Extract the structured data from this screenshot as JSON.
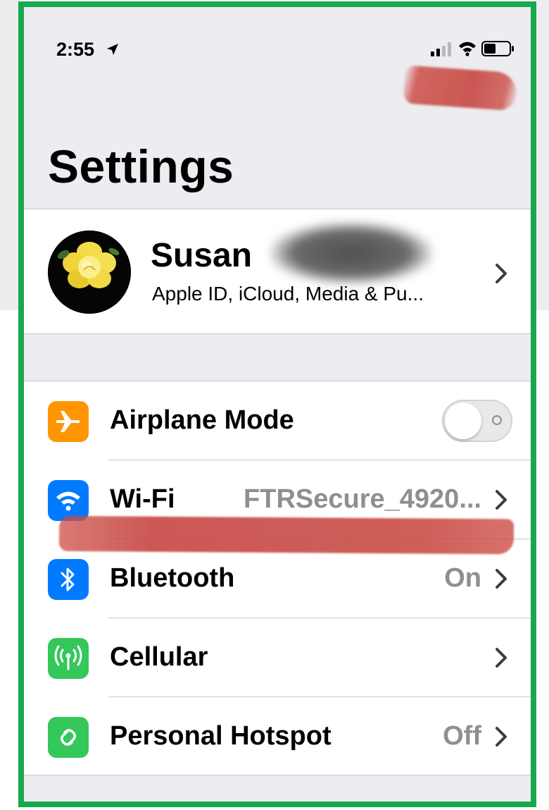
{
  "status_bar": {
    "time": "2:55"
  },
  "page": {
    "title": "Settings"
  },
  "profile": {
    "name": "Susan",
    "subtitle": "Apple ID, iCloud, Media & Pu..."
  },
  "settings": {
    "items": [
      {
        "label": "Airplane Mode",
        "value": "",
        "icon": "airplane-icon",
        "icon_color": "#ff9500",
        "control": "toggle",
        "toggle_on": false
      },
      {
        "label": "Wi-Fi",
        "value": "FTRSecure_4920...",
        "icon": "wifi-icon",
        "icon_color": "#007aff",
        "control": "chevron"
      },
      {
        "label": "Bluetooth",
        "value": "On",
        "icon": "bluetooth-icon",
        "icon_color": "#007aff",
        "control": "chevron"
      },
      {
        "label": "Cellular",
        "value": "",
        "icon": "cellular-icon",
        "icon_color": "#34c759",
        "control": "chevron"
      },
      {
        "label": "Personal Hotspot",
        "value": "Off",
        "icon": "hotspot-icon",
        "icon_color": "#34c759",
        "control": "chevron"
      }
    ]
  },
  "colors": {
    "frame_border": "#16a94d",
    "background": "#ececf1",
    "secondary_text": "#8e8e93",
    "chevron": "#3c3c43"
  }
}
